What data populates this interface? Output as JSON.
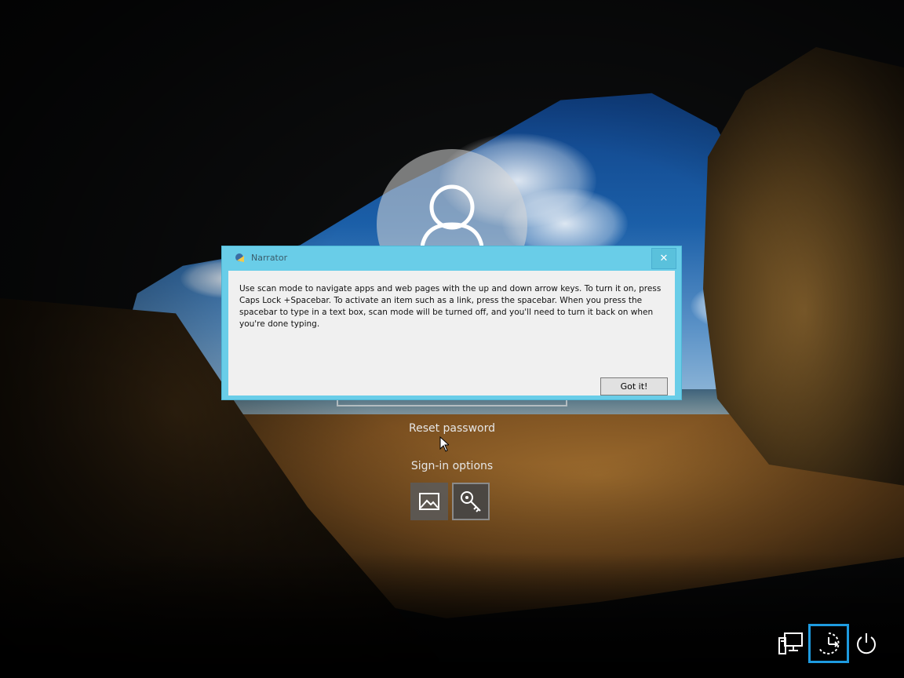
{
  "lock_screen": {
    "reset_password_link": "Reset password",
    "signin_options_label": "Sign-in options"
  },
  "narrator_dialog": {
    "title": "Narrator",
    "message": "Use scan mode to navigate apps and web pages with the up and down arrow keys. To turn it on, press Caps Lock +Spacebar. To activate an item such as a link, press the spacebar. When you press the spacebar to type in a text box, scan mode will be turned off, and you'll need to turn it back on when you're done typing.",
    "close_glyph": "✕",
    "got_it_label": "Got it!"
  },
  "icons": {
    "avatar": "user-icon",
    "signin_options": [
      "picture-password-icon",
      "key-icon"
    ],
    "corner": [
      "network-icon",
      "ease-of-access-icon",
      "power-icon"
    ]
  },
  "colors": {
    "dialog_titlebar": "#69cde8",
    "focus_ring": "#1e9be0"
  }
}
